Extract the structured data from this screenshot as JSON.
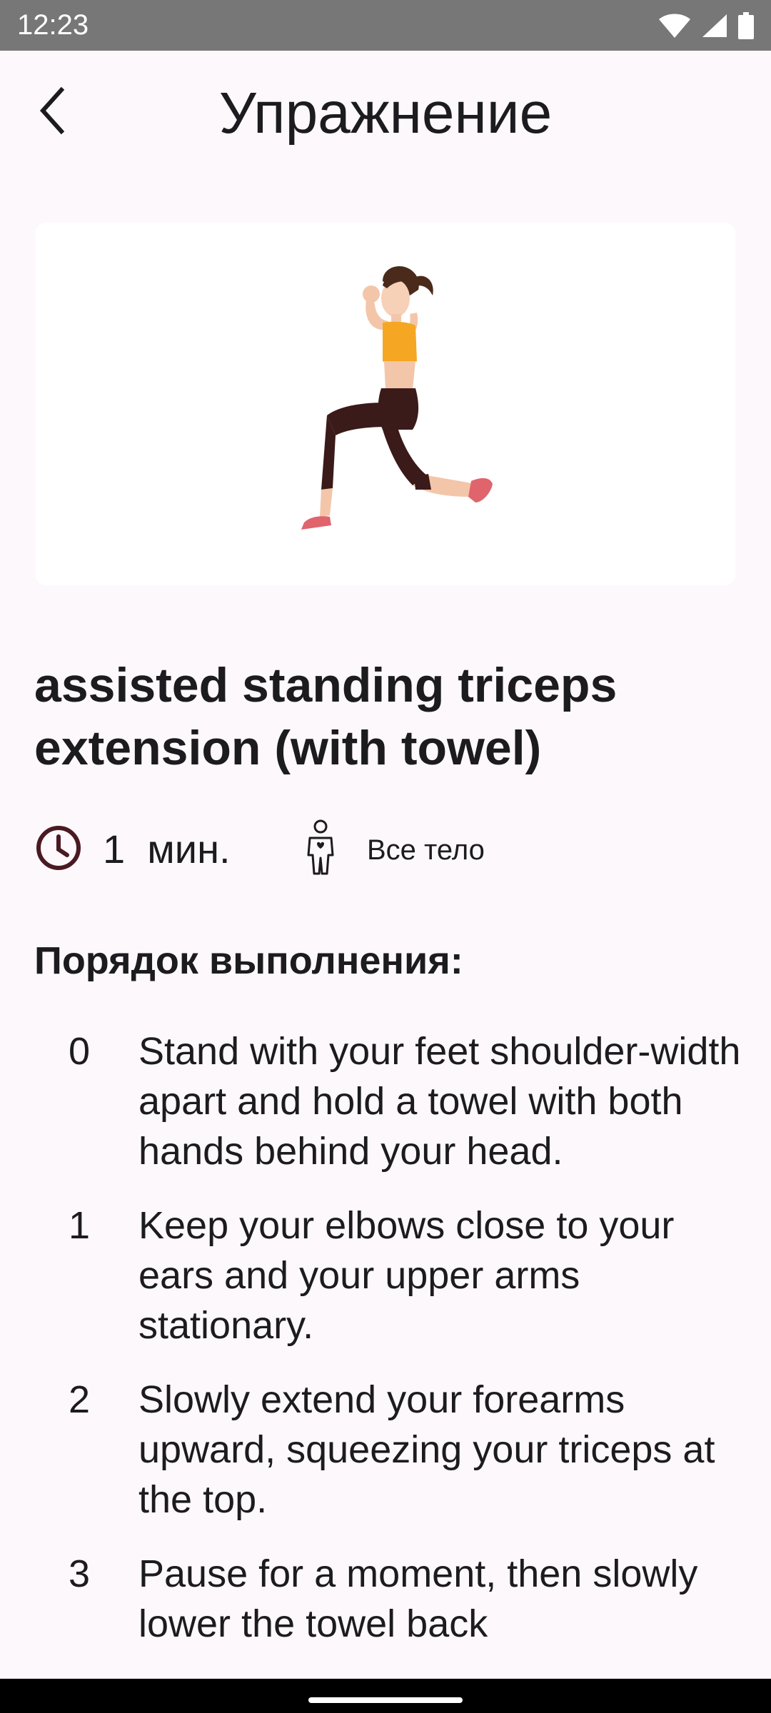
{
  "status": {
    "time": "12:23"
  },
  "header": {
    "title": "Упражнение"
  },
  "exercise": {
    "name": "assisted standing triceps extension (with towel)",
    "duration_value": "1",
    "duration_unit": "мин.",
    "target": "Все тело"
  },
  "instructions": {
    "heading": "Порядок выполнения:",
    "steps": [
      {
        "index": "0",
        "text": "Stand with your feet shoulder-width apart and hold a towel with both hands behind your head."
      },
      {
        "index": "1",
        "text": "Keep your elbows close to your ears and your upper arms stationary."
      },
      {
        "index": "2",
        "text": "Slowly extend your forearms upward, squeezing your triceps at the top."
      },
      {
        "index": "3",
        "text": "Pause for a moment, then slowly lower the towel back"
      }
    ]
  },
  "colors": {
    "background": "#fdf8fc",
    "status_bar": "#777777",
    "clock_icon": "#4a1a22",
    "sports_top": "#f5a623",
    "leggings": "#3b1a1a",
    "shoes": "#e0646c"
  },
  "icons": {
    "back": "arrow-back-icon",
    "clock": "clock-icon",
    "body": "body-icon",
    "wifi": "wifi-icon",
    "signal": "signal-icon",
    "battery": "battery-icon"
  }
}
